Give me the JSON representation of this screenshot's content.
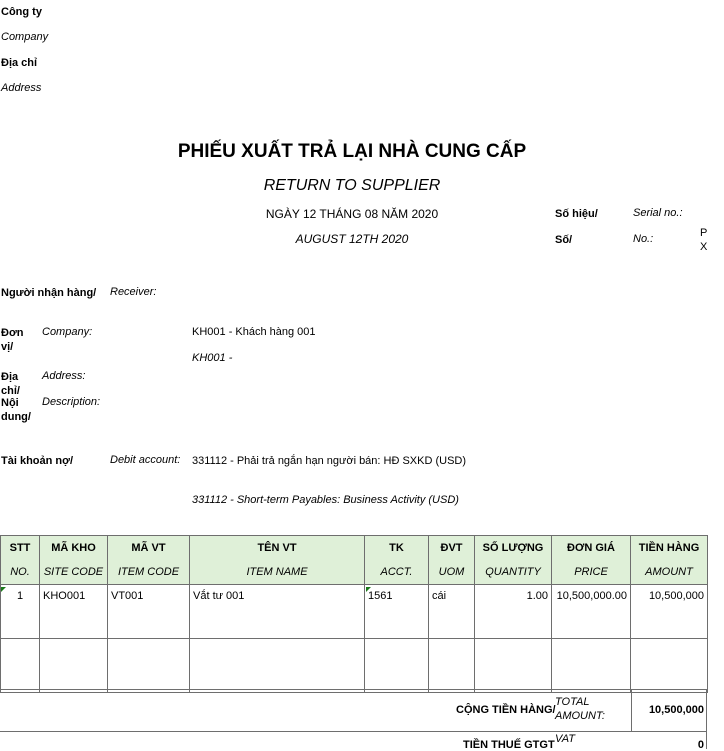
{
  "header": {
    "company_label": "Công ty",
    "company_label_en": "Company",
    "address_label": "Địa chỉ",
    "address_label_en": "Address"
  },
  "title": {
    "main": "PHIẾU XUẤT TRẢ LẠI NHÀ CUNG CẤP",
    "sub": "RETURN TO SUPPLIER",
    "date_vn": "NGÀY 12 THÁNG 08 NĂM 2020",
    "date_en": "AUGUST 12TH 2020"
  },
  "serial": {
    "serial_label": "Số hiệu/",
    "serial_label_en": "Serial no.:",
    "no_label": "Số/",
    "no_label_en": "No.:",
    "value_line1": "P",
    "value_line2": "X"
  },
  "info": {
    "receiver_label": "Người nhận hàng/",
    "receiver_label_en": "Receiver:",
    "unit_label_1": "Đơn",
    "unit_label_2": "vị/",
    "unit_label_en": "Company:",
    "unit_value_vn": "KH001 - Khách hàng 001",
    "unit_value_en": "KH001 -",
    "address_label_1": "Địa",
    "address_label_2": "chỉ/",
    "address_label_en": "Address:",
    "desc_label_1": "Nội",
    "desc_label_2": "dung/",
    "desc_label_en": "Description:",
    "debit_label": "Tài khoản nợ/",
    "debit_label_en": "Debit account:",
    "debit_value_vn": "331112 - Phải trả ngắn hạn người bán: HĐ SXKD (USD)",
    "debit_value_en": "331112 - Short-term Payables: Business Activity (USD)"
  },
  "table": {
    "headers_vn": [
      "STT",
      "MÃ KHO",
      "MÃ VT",
      "TÊN VT",
      "TK",
      "ĐVT",
      "SỐ LƯỢNG",
      "ĐƠN GIÁ",
      "TIỀN HÀNG"
    ],
    "headers_en": [
      "NO.",
      "SITE CODE",
      "ITEM CODE",
      "ITEM NAME",
      "ACCT.",
      "UOM",
      "QUANTITY",
      "PRICE",
      "AMOUNT"
    ],
    "rows": [
      {
        "stt": "1",
        "site": "KHO001",
        "item_code": "VT001",
        "item_name": "Vắt tư 001",
        "acct": "1561",
        "uom": "cái",
        "qty": "1.00",
        "price": "10,500,000.00",
        "amount": "10,500,000"
      }
    ]
  },
  "totals": {
    "total_label": "CỘNG TIỀN HÀNG/",
    "total_label_en_1": "TOTAL",
    "total_label_en_2": "AMOUNT:",
    "total_value": "10,500,000",
    "vat_label": "TIỀN THUẾ GTGT",
    "vat_label_en": "VAT",
    "vat_value": "0"
  }
}
